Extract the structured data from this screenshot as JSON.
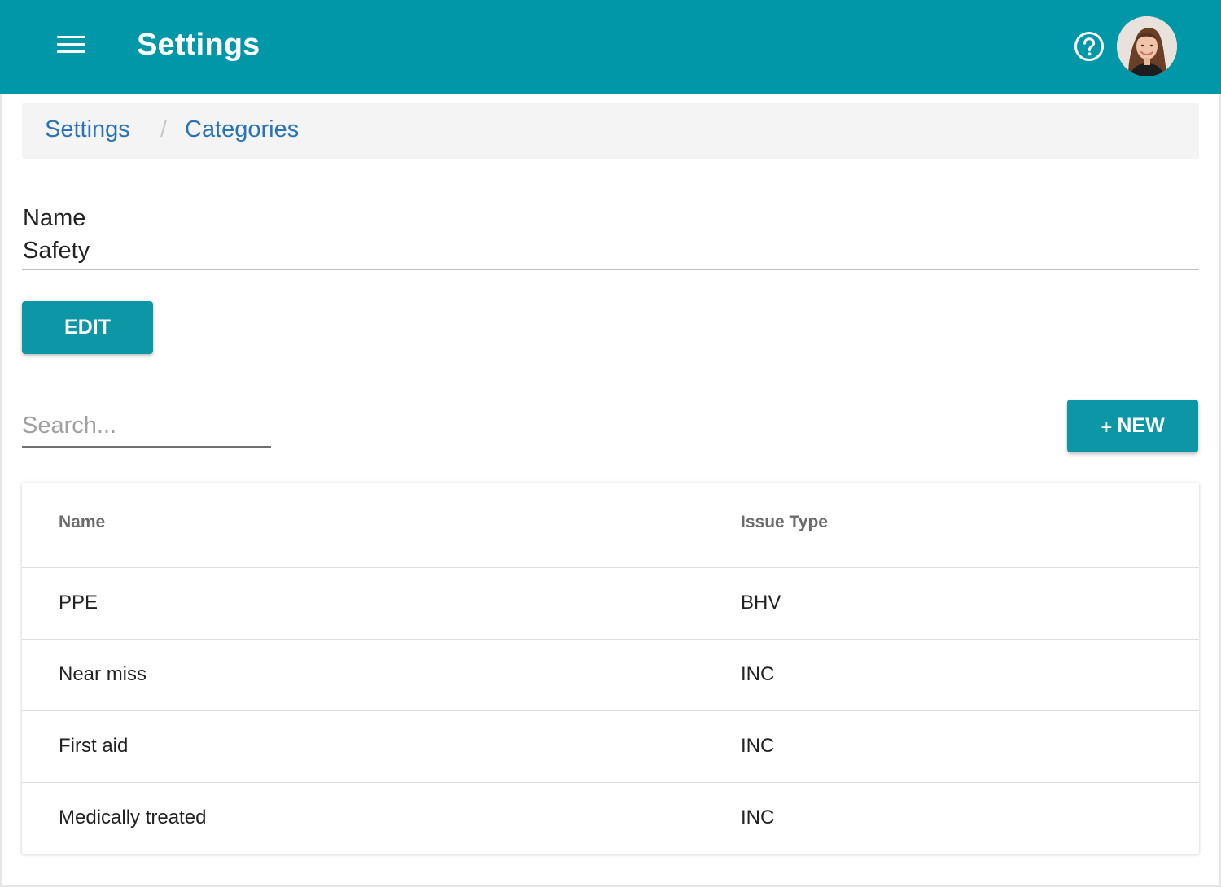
{
  "header": {
    "title": "Settings",
    "menu_icon": "hamburger-menu-icon",
    "help_icon": "help-circle-icon",
    "avatar": "user-avatar",
    "bg_color": "#0098a8"
  },
  "breadcrumb": {
    "items": [
      "Settings",
      "Categories"
    ],
    "separator": "/"
  },
  "detail": {
    "label": "Name",
    "value": "Safety",
    "edit_label": "EDIT"
  },
  "toolbar": {
    "search_placeholder": "Search...",
    "new_plus": "+",
    "new_label": "NEW"
  },
  "table": {
    "columns": [
      "Name",
      "Issue Type"
    ],
    "rows": [
      {
        "name": "PPE",
        "issue_type": "BHV"
      },
      {
        "name": "Near miss",
        "issue_type": "INC"
      },
      {
        "name": "First aid",
        "issue_type": "INC"
      },
      {
        "name": "Medically treated",
        "issue_type": "INC"
      }
    ]
  },
  "colors": {
    "primary": "#0098a8",
    "link": "#2a73b8"
  }
}
